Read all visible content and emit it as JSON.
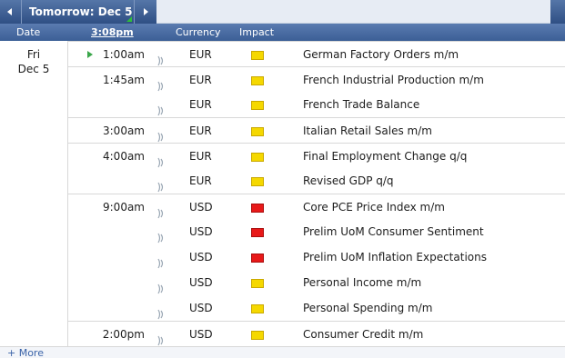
{
  "nav": {
    "title": "Tomorrow: Dec 5"
  },
  "header": {
    "date": "Date",
    "time": "3:08pm",
    "currency": "Currency",
    "impact": "Impact"
  },
  "day": {
    "weekday": "Fri",
    "date": "Dec 5"
  },
  "events": [
    {
      "time": "1:00am",
      "currency": "EUR",
      "impact": "low",
      "event": "German Factory Orders m/m",
      "next": true
    },
    {
      "time": "1:45am",
      "currency": "EUR",
      "impact": "low",
      "event": "French Industrial Production m/m"
    },
    {
      "time": "",
      "currency": "EUR",
      "impact": "low",
      "event": "French Trade Balance"
    },
    {
      "time": "3:00am",
      "currency": "EUR",
      "impact": "low",
      "event": "Italian Retail Sales m/m"
    },
    {
      "time": "4:00am",
      "currency": "EUR",
      "impact": "low",
      "event": "Final Employment Change q/q"
    },
    {
      "time": "",
      "currency": "EUR",
      "impact": "low",
      "event": "Revised GDP q/q"
    },
    {
      "time": "9:00am",
      "currency": "USD",
      "impact": "high",
      "event": "Core PCE Price Index m/m"
    },
    {
      "time": "",
      "currency": "USD",
      "impact": "high",
      "event": "Prelim UoM Consumer Sentiment"
    },
    {
      "time": "",
      "currency": "USD",
      "impact": "high",
      "event": "Prelim UoM Inflation Expectations"
    },
    {
      "time": "",
      "currency": "USD",
      "impact": "low",
      "event": "Personal Income m/m"
    },
    {
      "time": "",
      "currency": "USD",
      "impact": "low",
      "event": "Personal Spending m/m"
    },
    {
      "time": "2:00pm",
      "currency": "USD",
      "impact": "low",
      "event": "Consumer Credit m/m"
    }
  ],
  "impact_colors": {
    "low": "#f5d800",
    "high": "#e81919"
  },
  "footer": {
    "more": "+ More"
  }
}
